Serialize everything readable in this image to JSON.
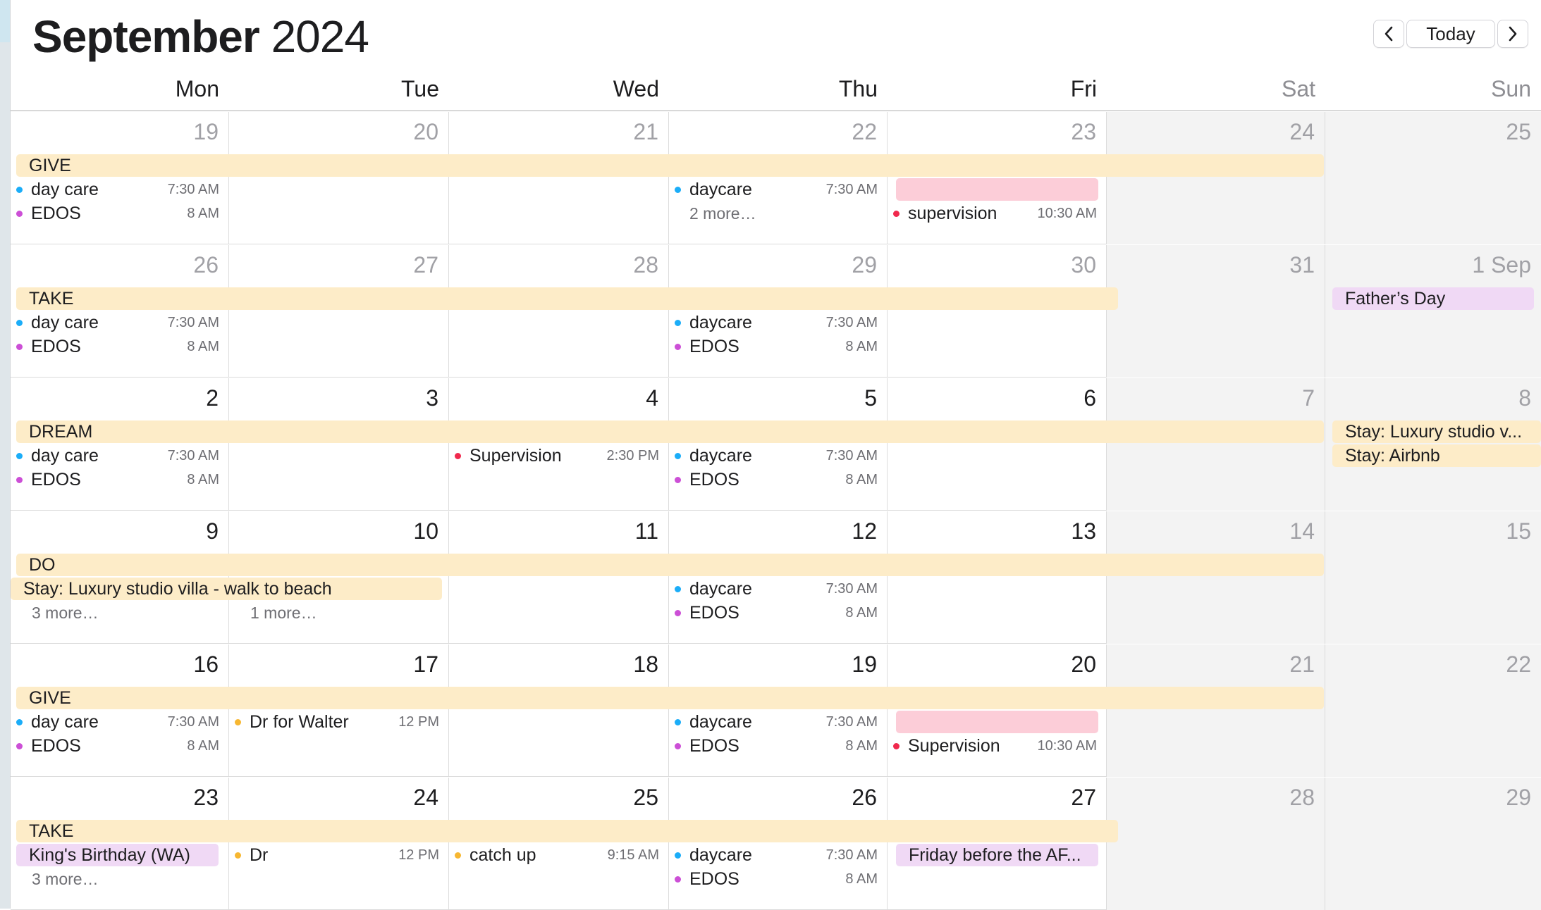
{
  "header": {
    "month": "September",
    "year": "2024",
    "today_label": "Today",
    "prev_icon": "chevron-left-icon",
    "next_icon": "chevron-right-icon"
  },
  "weekdays": [
    "Mon",
    "Tue",
    "Wed",
    "Thu",
    "Fri",
    "Sat",
    "Sun"
  ],
  "colors": {
    "blue": "#1badf8",
    "magenta": "#cc4fd6",
    "red": "#f0294d",
    "orange": "#f7b731",
    "banner_yellow": "#fdecc8",
    "banner_pink": "#fccdd8",
    "banner_purple": "#f0d9f5"
  },
  "weeks": [
    {
      "days": [
        "19",
        "20",
        "21",
        "22",
        "23",
        "24",
        "25"
      ],
      "day_other_month": [
        true,
        true,
        true,
        true,
        true,
        true,
        true
      ],
      "banner": "GIVE",
      "events": {
        "mon": [
          {
            "title": "day care",
            "time": "7:30 AM",
            "color": "blue"
          },
          {
            "title": "EDOS",
            "time": "8 AM",
            "color": "magenta"
          }
        ],
        "thu": [
          {
            "title": "daycare",
            "time": "7:30 AM",
            "color": "blue"
          }
        ],
        "thu_more": "2 more…",
        "fri": [
          {
            "title": "supervision",
            "time": "10:30 AM",
            "color": "red"
          }
        ]
      }
    },
    {
      "days": [
        "26",
        "27",
        "28",
        "29",
        "30",
        "31",
        "1 Sep"
      ],
      "day_other_month": [
        true,
        true,
        true,
        true,
        true,
        true,
        false
      ],
      "banner": "TAKE",
      "sun_banner": "Father’s Day",
      "events": {
        "mon": [
          {
            "title": "day care",
            "time": "7:30 AM",
            "color": "blue"
          },
          {
            "title": "EDOS",
            "time": "8 AM",
            "color": "magenta"
          }
        ],
        "thu": [
          {
            "title": "daycare",
            "time": "7:30 AM",
            "color": "blue"
          },
          {
            "title": "EDOS",
            "time": "8 AM",
            "color": "magenta"
          }
        ]
      }
    },
    {
      "days": [
        "2",
        "3",
        "4",
        "5",
        "6",
        "7",
        "8"
      ],
      "banner": "DREAM",
      "sun_banners": [
        "Stay: Luxury studio v...",
        "Stay: Airbnb"
      ],
      "events": {
        "mon": [
          {
            "title": "day care",
            "time": "7:30 AM",
            "color": "blue"
          },
          {
            "title": "EDOS",
            "time": "8 AM",
            "color": "magenta"
          }
        ],
        "wed": [
          {
            "title": "Supervision",
            "time": "2:30 PM",
            "color": "red"
          }
        ],
        "thu": [
          {
            "title": "daycare",
            "time": "7:30 AM",
            "color": "blue"
          },
          {
            "title": "EDOS",
            "time": "8 AM",
            "color": "magenta"
          }
        ]
      }
    },
    {
      "days": [
        "9",
        "10",
        "11",
        "12",
        "13",
        "14",
        "15"
      ],
      "banner": "DO",
      "stay_banner": "Stay: Luxury studio villa - walk to beach",
      "mon_more": "3 more…",
      "tue_more": "1 more…",
      "events": {
        "thu": [
          {
            "title": "daycare",
            "time": "7:30 AM",
            "color": "blue"
          },
          {
            "title": "EDOS",
            "time": "8 AM",
            "color": "magenta"
          }
        ]
      }
    },
    {
      "days": [
        "16",
        "17",
        "18",
        "19",
        "20",
        "21",
        "22"
      ],
      "banner": "GIVE",
      "events": {
        "mon": [
          {
            "title": "day care",
            "time": "7:30 AM",
            "color": "blue"
          },
          {
            "title": "EDOS",
            "time": "8 AM",
            "color": "magenta"
          }
        ],
        "tue": [
          {
            "title": "Dr for Walter",
            "time": "12 PM",
            "color": "orange"
          }
        ],
        "thu": [
          {
            "title": "daycare",
            "time": "7:30 AM",
            "color": "blue"
          },
          {
            "title": "EDOS",
            "time": "8 AM",
            "color": "magenta"
          }
        ],
        "fri": [
          {
            "title": "Supervision",
            "time": "10:30 AM",
            "color": "red"
          }
        ]
      }
    },
    {
      "days": [
        "23",
        "24",
        "25",
        "26",
        "27",
        "28",
        "29"
      ],
      "banner": "TAKE",
      "mon_banner": "King's Birthday (WA)",
      "mon_more": "3 more…",
      "fri_banner": "Friday before the AF...",
      "events": {
        "tue": [
          {
            "title": "Dr",
            "time": "12 PM",
            "color": "orange"
          }
        ],
        "wed": [
          {
            "title": "catch up",
            "time": "9:15 AM",
            "color": "orange"
          }
        ],
        "thu": [
          {
            "title": "daycare",
            "time": "7:30 AM",
            "color": "blue"
          },
          {
            "title": "EDOS",
            "time": "8 AM",
            "color": "magenta"
          }
        ]
      }
    }
  ]
}
